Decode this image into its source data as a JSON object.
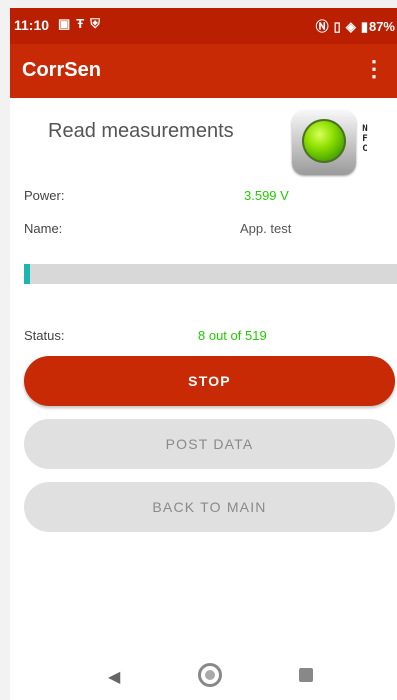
{
  "status_bar": {
    "time": "11:10",
    "left_icons": [
      "image-icon",
      "t-mobile-icon",
      "shield-icon"
    ],
    "right_icons": [
      "nfc-icon",
      "vibrate-icon",
      "wifi-icon",
      "battery-icon"
    ],
    "battery": "87%"
  },
  "app_bar": {
    "title": "CorrSen",
    "menu_icon": "more-vert-icon"
  },
  "main": {
    "heading": "Read measurements",
    "nfc_label": "N F C",
    "nfc_status_color": "#8ee000",
    "power_label": "Power:",
    "power_value": "3.599 V",
    "name_label": "Name:",
    "name_value": "App. test",
    "progress": 0.0154,
    "status_label": "Status:",
    "status_value": "8 out of 519"
  },
  "buttons": {
    "stop": "STOP",
    "post_data": "POST DATA",
    "back_to_main": "BACK TO MAIN"
  },
  "colors": {
    "accent": "#c82a06",
    "status_green": "#22cc00",
    "progress": "#1ab6b0"
  },
  "nav_bar": {
    "back_icon": "back-triangle-icon",
    "home_icon": "home-circle-icon",
    "recent_icon": "recent-square-icon"
  }
}
